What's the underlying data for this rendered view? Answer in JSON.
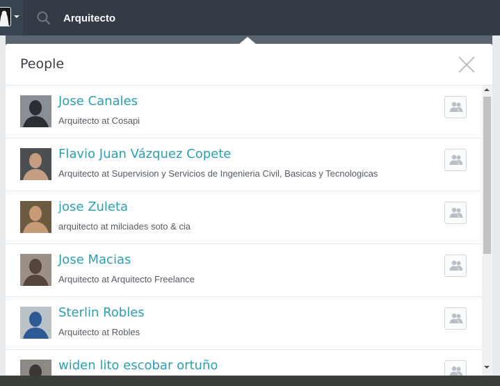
{
  "search": {
    "value": "Arquitecto"
  },
  "panel": {
    "title": "People"
  },
  "people": [
    {
      "name": "Jose Canales",
      "headline": "Arquitecto at Cosapi",
      "thumb_bg": "#8a8f95",
      "thumb_fg": "#2b2e33"
    },
    {
      "name": "Flavio Juan Vázquez Copete",
      "headline": "Arquitecto at Supervision y Servicios de Ingenieria Civil, Basicas y Tecnologicas",
      "thumb_bg": "#4b4f52",
      "thumb_fg": "#c59d80"
    },
    {
      "name": "jose Zuleta",
      "headline": "arquitecto at milciades soto & cia",
      "thumb_bg": "#6b5a3f",
      "thumb_fg": "#c89b77"
    },
    {
      "name": "Jose Macias",
      "headline": "Arquitecto at Arquitecto Freelance",
      "thumb_bg": "#9c8f86",
      "thumb_fg": "#55443c"
    },
    {
      "name": "Sterlin Robles",
      "headline": "Arquitecto at Robles",
      "thumb_bg": "#b9c3c7",
      "thumb_fg": "#2d5a95"
    },
    {
      "name": "widen lito escobar ortuño",
      "headline": "",
      "thumb_bg": "#8d8a86",
      "thumb_fg": "#3b3733"
    }
  ],
  "colors": {
    "link": "#2a9fb6",
    "topbar": "#3a4450"
  }
}
